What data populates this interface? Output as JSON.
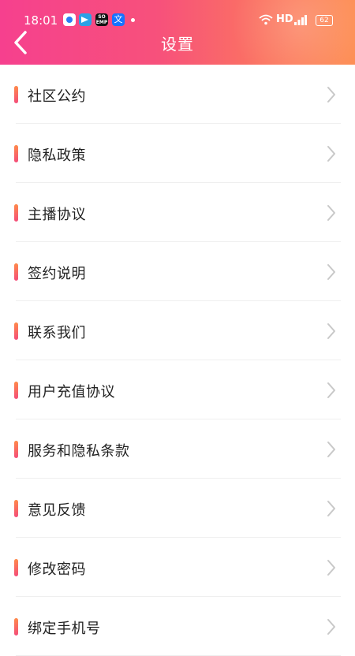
{
  "status_bar": {
    "time": "18:01",
    "network": "HD",
    "battery": "62",
    "notifications": [
      "app-circle-icon",
      "telegram-icon",
      "soemp-icon",
      "translate-icon"
    ],
    "soemp_label": "SO\nEMP",
    "translate_label": "文"
  },
  "header": {
    "title": "设置",
    "back_icon": "chevron-left-icon",
    "gradient": [
      "#f6408e",
      "#fd8f55"
    ]
  },
  "menu": {
    "items": [
      {
        "label": "社区公约"
      },
      {
        "label": "隐私政策"
      },
      {
        "label": "主播协议"
      },
      {
        "label": "签约说明"
      },
      {
        "label": "联系我们"
      },
      {
        "label": "用户充值协议"
      },
      {
        "label": "服务和隐私条款"
      },
      {
        "label": "意见反馈"
      },
      {
        "label": "修改密码"
      },
      {
        "label": "绑定手机号"
      }
    ],
    "accent_gradient": [
      "#ff8a4a",
      "#f44d7a"
    ],
    "chevron_icon": "chevron-right-icon"
  }
}
